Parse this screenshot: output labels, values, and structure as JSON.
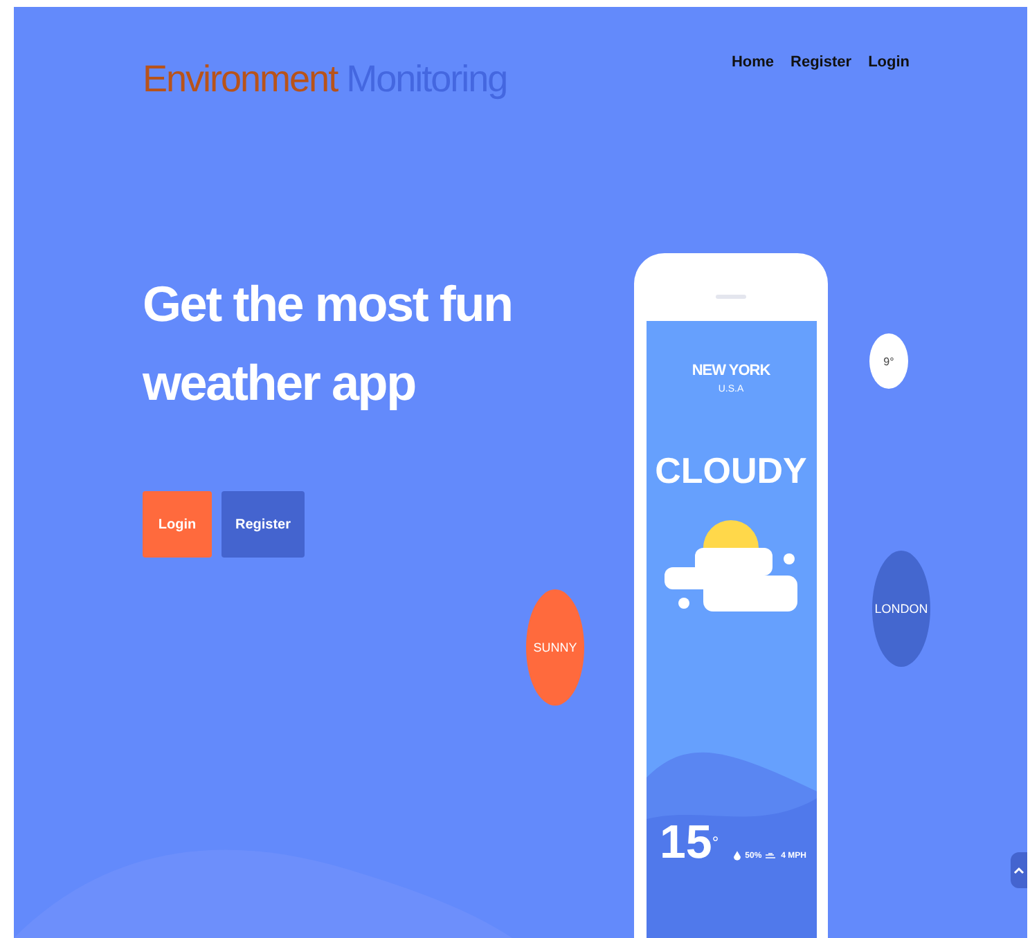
{
  "brand": {
    "first": "Environment",
    "second": "Monitoring"
  },
  "nav": [
    "Home",
    "Register",
    "Login"
  ],
  "hero": {
    "heading": "Get the most fun weather app",
    "buttons": [
      {
        "label": "Login",
        "kind": "primary"
      },
      {
        "label": "Register",
        "kind": "secondary"
      }
    ]
  },
  "phone": {
    "city": "NEW YORK",
    "country": "U.S.A",
    "condition": "CLOUDY",
    "temperature": "15",
    "degree": "°",
    "humidity": "50%",
    "wind": "4 MPH"
  },
  "bubbles": [
    {
      "label": "9°",
      "color": "#ffffff",
      "kind": "small"
    },
    {
      "label": "SUNNY",
      "color": "#ff6a3d",
      "kind": "large"
    },
    {
      "label": "LONDON",
      "color": "#4467cf",
      "kind": "large"
    }
  ]
}
